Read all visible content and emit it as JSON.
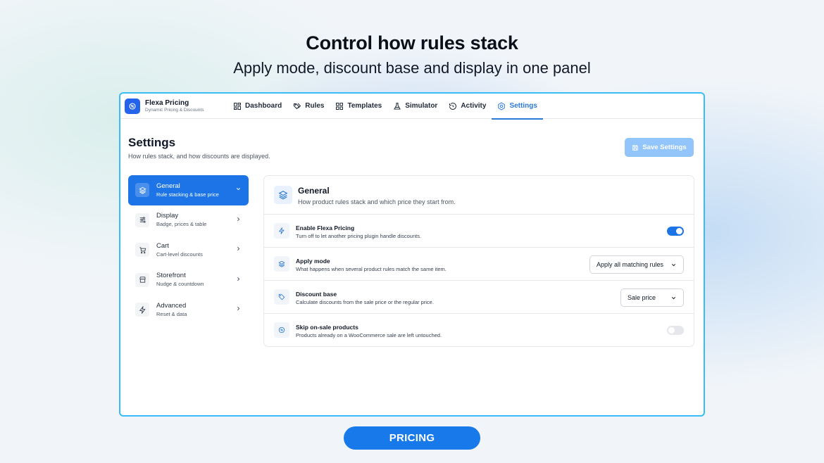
{
  "hero": {
    "title": "Control how rules stack",
    "subtitle": "Apply mode, discount base and display in one panel"
  },
  "brand": {
    "name": "Flexa Pricing",
    "tagline": "Dynamic Pricing & Discounts",
    "icon": "badge-icon"
  },
  "nav": {
    "tabs": [
      {
        "label": "Dashboard",
        "icon": "grid-icon"
      },
      {
        "label": "Rules",
        "icon": "tags-icon"
      },
      {
        "label": "Templates",
        "icon": "grid-icon"
      },
      {
        "label": "Simulator",
        "icon": "flask-icon"
      },
      {
        "label": "Activity",
        "icon": "history-icon"
      },
      {
        "label": "Settings",
        "icon": "gear-icon",
        "active": true
      }
    ]
  },
  "page": {
    "title": "Settings",
    "subtitle": "How rules stack, and how discounts are displayed.",
    "save_label": "Save Settings"
  },
  "sidebar": {
    "items": [
      {
        "label": "General",
        "desc": "Rule stacking & base price",
        "icon": "layers-icon",
        "active": true
      },
      {
        "label": "Display",
        "desc": "Badge, prices & table",
        "icon": "sliders-icon"
      },
      {
        "label": "Cart",
        "desc": "Cart-level discounts",
        "icon": "cart-icon"
      },
      {
        "label": "Storefront",
        "desc": "Nudge & countdown",
        "icon": "store-icon"
      },
      {
        "label": "Advanced",
        "desc": "Reset & data",
        "icon": "bolt-icon"
      }
    ]
  },
  "panel": {
    "title": "General",
    "subtitle": "How product rules stack and which price they start from.",
    "rows": [
      {
        "label": "Enable Flexa Pricing",
        "desc": "Turn off to let another pricing plugin handle discounts.",
        "icon": "bolt-icon",
        "control": "toggle",
        "enabled": true
      },
      {
        "label": "Apply mode",
        "desc": "What happens when several product rules match the same item.",
        "icon": "layers-icon",
        "control": "select",
        "value": "Apply all matching rules"
      },
      {
        "label": "Discount base",
        "desc": "Calculate discounts from the sale price or the regular price.",
        "icon": "tag-icon",
        "control": "select",
        "value": "Sale price"
      },
      {
        "label": "Skip on-sale products",
        "desc": "Products already on a WooCommerce sale are left untouched.",
        "icon": "percent-badge-icon",
        "control": "toggle",
        "enabled": false
      }
    ]
  },
  "footer_pill": "PRICING",
  "colors": {
    "accent": "#1d74e7",
    "window_border": "#38bdf8",
    "save_button": "#93c5fd"
  }
}
